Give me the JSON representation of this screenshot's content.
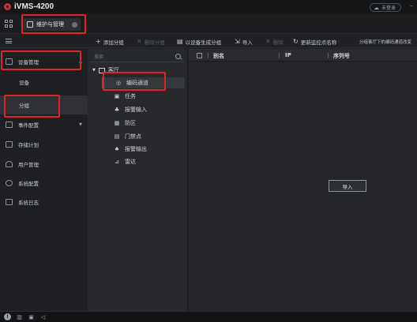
{
  "app": {
    "title": "iVMS-4200",
    "login_status": "未登录"
  },
  "tabs": [
    {
      "label": "维护与管理"
    }
  ],
  "toolbar": {
    "items": [
      {
        "icon": "plus-icon",
        "glyph": "+",
        "label": "添加分组"
      },
      {
        "icon": "close-icon",
        "glyph": "✕",
        "label": "删除分组"
      },
      {
        "icon": "device-icon",
        "glyph": "▤",
        "label": "以设备生成分组"
      },
      {
        "icon": "import-icon",
        "glyph": "⇲",
        "label": "导入"
      },
      {
        "icon": "close-icon",
        "glyph": "✕",
        "label": "删除"
      },
      {
        "icon": "refresh-icon",
        "glyph": "↻",
        "label": "更新监控点名称"
      },
      {
        "icon": "none",
        "glyph": "",
        "label": "分组事厅下的编码通道改变"
      }
    ]
  },
  "nav": {
    "items": [
      {
        "label": "设备管理",
        "icon": "device-management-icon",
        "arrow": "▲"
      },
      {
        "label": "设备",
        "sub": true
      },
      {
        "label": "分组",
        "sub": true
      },
      {
        "label": "事件配置",
        "icon": "event-config-icon",
        "arrow": "▼"
      },
      {
        "label": "存储计划",
        "icon": "storage-plan-icon"
      },
      {
        "label": "用户管理",
        "icon": "user-management-icon"
      },
      {
        "label": "系统配置",
        "icon": "system-config-icon"
      },
      {
        "label": "系统日志",
        "icon": "system-log-icon"
      }
    ]
  },
  "tree": {
    "search_placeholder": "搜索",
    "root": {
      "label": "客厅",
      "arrow": "▼"
    },
    "nodes": [
      {
        "label": "编码通道",
        "icon": "encoding-channel-icon",
        "glyph": "◎"
      },
      {
        "label": "任务",
        "icon": "task-icon",
        "glyph": "▣"
      },
      {
        "label": "报警输入",
        "icon": "alarm-input-icon",
        "glyph": "♣"
      },
      {
        "label": "防区",
        "icon": "zone-icon",
        "glyph": "▦"
      },
      {
        "label": "门禁点",
        "icon": "access-point-icon",
        "glyph": "▤"
      },
      {
        "label": "报警输出",
        "icon": "alarm-output-icon",
        "glyph": "♠"
      },
      {
        "label": "雷达",
        "icon": "radar-icon",
        "glyph": "⊿"
      }
    ]
  },
  "table": {
    "columns": [
      "别名",
      "IP",
      "序列号"
    ],
    "import_button": "导入"
  },
  "colors": {
    "highlight": "#e0242b",
    "background": "#1f2124"
  }
}
